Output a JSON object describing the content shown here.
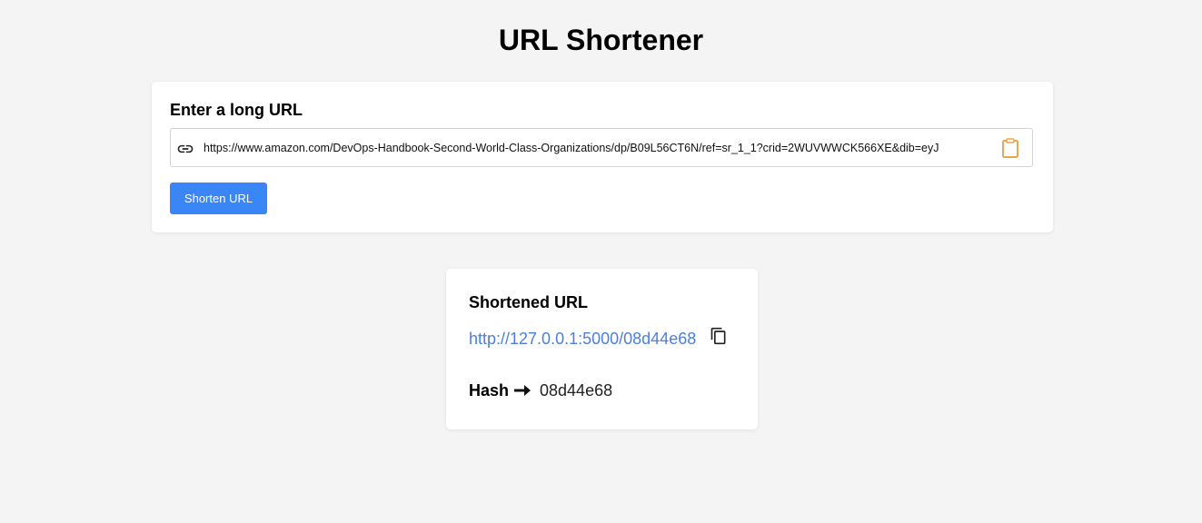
{
  "header": {
    "title": "URL Shortener"
  },
  "input_card": {
    "heading": "Enter a long URL",
    "url_value": "https://www.amazon.com/DevOps-Handbook-Second-World-Class-Organizations/dp/B09L56CT6N/ref=sr_1_1?crid=2WUVWWCK566XE&dib=eyJ",
    "shorten_label": "Shorten URL",
    "link_icon": "link-icon",
    "paste_icon": "clipboard-icon"
  },
  "result_card": {
    "heading": "Shortened URL",
    "short_url": "http://127.0.0.1:5000/08d44e68",
    "copy_icon": "copy-icon",
    "hash_label": "Hash",
    "arrow_icon": "arrow-right-icon",
    "hash_value": "08d44e68"
  },
  "colors": {
    "background": "#f4f4f4",
    "button": "#3b86f7",
    "link": "#4a7fe0",
    "clipboard_accent": "#e8a64a"
  }
}
